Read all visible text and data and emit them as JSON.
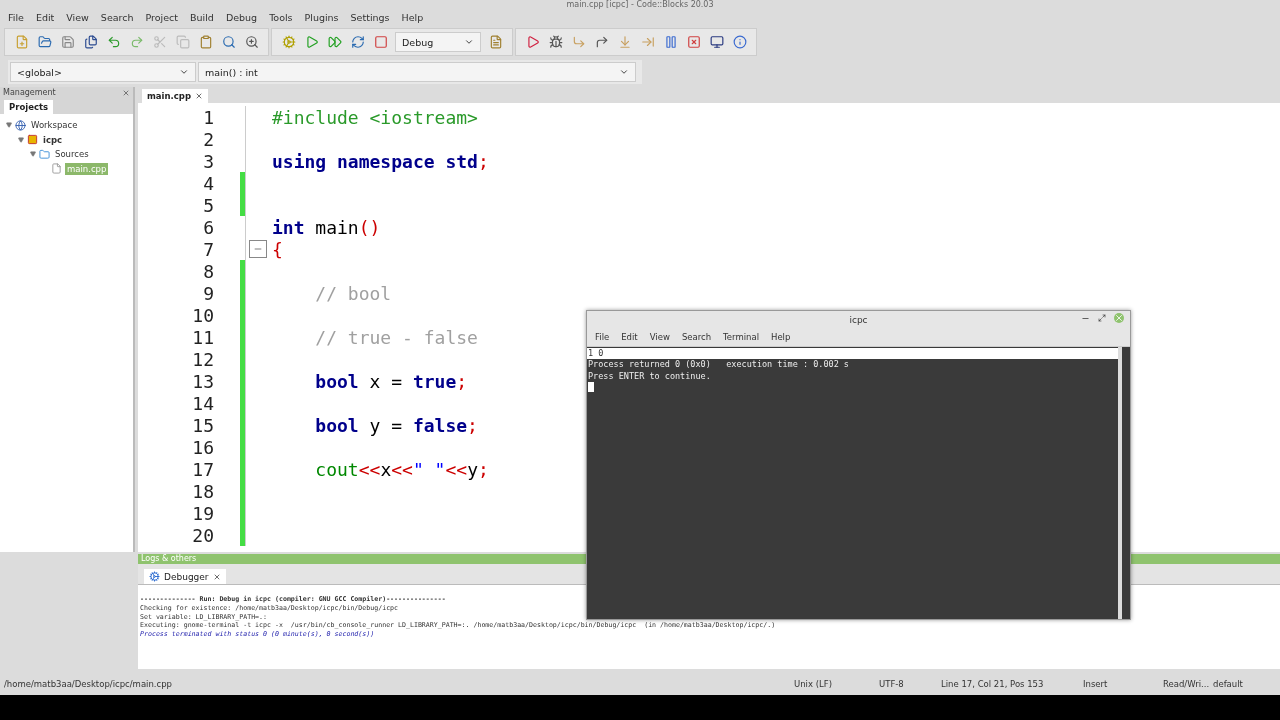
{
  "window": {
    "title": "main.cpp [icpc] - Code::Blocks 20.03"
  },
  "menu": [
    "File",
    "Edit",
    "View",
    "Search",
    "Project",
    "Build",
    "Debug",
    "Tools",
    "Plugins",
    "Settings",
    "Help"
  ],
  "toolbar": {
    "build_target": "Debug"
  },
  "scope_bar": {
    "scope": "<global>",
    "symbol": "main() : int"
  },
  "management": {
    "title": "Management",
    "tabs": [
      {
        "label": "Projects",
        "selected": true
      }
    ],
    "tree": [
      {
        "label": "Workspace",
        "kind": "workspace",
        "expanded": true,
        "selected": false,
        "children": [
          {
            "label": "icpc",
            "kind": "project",
            "expanded": true,
            "selected": false,
            "children": [
              {
                "label": "Sources",
                "kind": "folder",
                "expanded": true,
                "selected": false,
                "children": [
                  {
                    "label": "main.cpp",
                    "kind": "file",
                    "selected": true
                  }
                ]
              }
            ]
          }
        ]
      }
    ]
  },
  "editor": {
    "tabs": [
      {
        "label": "main.cpp",
        "selected": true
      }
    ],
    "lines": [
      {
        "number": "1",
        "changed": false,
        "tokens": [
          {
            "kind": "preproc",
            "text": "#include <iostream>"
          }
        ]
      },
      {
        "number": "2",
        "changed": false
      },
      {
        "number": "3",
        "changed": false,
        "tokens": [
          {
            "kind": "keyword",
            "text": "using namespace std"
          },
          {
            "kind": "operator",
            "text": ";"
          }
        ]
      },
      {
        "number": "4",
        "changed": true
      },
      {
        "number": "5",
        "changed": true
      },
      {
        "number": "6",
        "changed": false,
        "tokens": [
          {
            "kind": "keyword",
            "text": "int"
          },
          {
            "kind": "plain",
            "text": " main"
          },
          {
            "kind": "operator",
            "text": "()"
          }
        ]
      },
      {
        "number": "7",
        "changed": false,
        "fold": true,
        "tokens": [
          {
            "kind": "operator",
            "text": "{"
          }
        ]
      },
      {
        "number": "8",
        "changed": true
      },
      {
        "number": "9",
        "changed": true,
        "tokens": [
          {
            "kind": "comment",
            "text": "    // bool"
          }
        ]
      },
      {
        "number": "10",
        "changed": true
      },
      {
        "number": "11",
        "changed": true,
        "tokens": [
          {
            "kind": "comment",
            "text": "    // true - false"
          }
        ]
      },
      {
        "number": "12",
        "changed": true
      },
      {
        "number": "13",
        "changed": true,
        "tokens": [
          {
            "kind": "keyword",
            "text": "    bool"
          },
          {
            "kind": "plain",
            "text": " x = "
          },
          {
            "kind": "keyword",
            "text": "true"
          },
          {
            "kind": "operator",
            "text": ";"
          }
        ]
      },
      {
        "number": "14",
        "changed": true
      },
      {
        "number": "15",
        "changed": true,
        "tokens": [
          {
            "kind": "keyword",
            "text": "    bool"
          },
          {
            "kind": "plain",
            "text": " y = "
          },
          {
            "kind": "keyword",
            "text": "false"
          },
          {
            "kind": "operator",
            "text": ";"
          }
        ]
      },
      {
        "number": "16",
        "changed": true
      },
      {
        "number": "17",
        "changed": true,
        "tokens": [
          {
            "kind": "identifier",
            "text": "    cout"
          },
          {
            "kind": "operator",
            "text": "<<"
          },
          {
            "kind": "plain",
            "text": "x"
          },
          {
            "kind": "operator",
            "text": "<<"
          },
          {
            "kind": "string",
            "text": "\" \""
          },
          {
            "kind": "operator",
            "text": "<<"
          },
          {
            "kind": "plain",
            "text": "y"
          },
          {
            "kind": "operator",
            "text": ";"
          }
        ]
      },
      {
        "number": "18",
        "changed": true
      },
      {
        "number": "19",
        "changed": true
      },
      {
        "number": "20",
        "changed": true
      }
    ]
  },
  "logs": {
    "title": "Logs & others",
    "tabs": [
      {
        "label": "Debugger",
        "selected": true
      }
    ],
    "lines": [
      {
        "kind": "header",
        "text": "-------------- Run: Debug in icpc (compiler: GNU GCC Compiler)---------------"
      },
      {
        "kind": "normal",
        "text": "Checking for existence: /home/matb3aa/Desktop/icpc/bin/Debug/icpc"
      },
      {
        "kind": "normal",
        "text": "Set variable: LD_LIBRARY_PATH=.:"
      },
      {
        "kind": "normal",
        "text": "Executing: gnome-terminal -t icpc -x  /usr/bin/cb_console_runner LD_LIBRARY_PATH=:. /home/matb3aa/Desktop/icpc/bin/Debug/icpc  (in /home/matb3aa/Desktop/icpc/.)"
      },
      {
        "kind": "status",
        "text": "Process terminated with status 0 (0 minute(s), 0 second(s))"
      }
    ]
  },
  "status_bar": {
    "file": "/home/matb3aa/Desktop/icpc/main.cpp",
    "eol": "Unix (LF)",
    "encoding": "UTF-8",
    "position": "Line 17, Col 21, Pos 153",
    "mode": "Insert",
    "access": "Read/Wri...",
    "theme": "default"
  },
  "terminal": {
    "title": "icpc",
    "menu": [
      "File",
      "Edit",
      "View",
      "Search",
      "Terminal",
      "Help"
    ],
    "lines": [
      {
        "text": "1 0",
        "highlighted": true
      },
      {
        "text": "Process returned 0 (0x0)   execution time : 0.002 s",
        "highlighted": false
      },
      {
        "text": "Press ENTER to continue.",
        "highlighted": false
      }
    ]
  }
}
